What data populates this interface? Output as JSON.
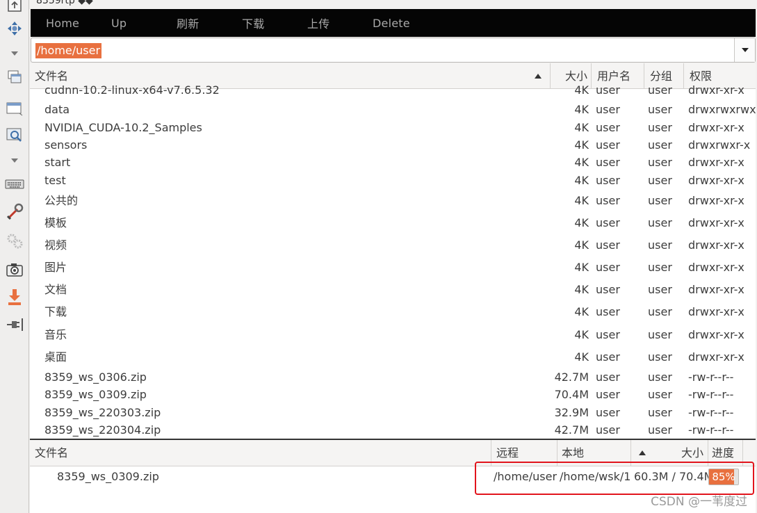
{
  "tab": {
    "title": "8359rtp ◆◆"
  },
  "toolbar": {
    "buttons": [
      "Home",
      "Up",
      "刷新",
      "下载",
      "上传",
      "Delete"
    ]
  },
  "path": {
    "value": "/home/user"
  },
  "file_table": {
    "headers": {
      "name": "文件名",
      "size": "大小",
      "owner": "用户名",
      "group": "分组",
      "perms": "权限"
    },
    "sort": "ascending",
    "rows": [
      {
        "name": "cudnn-10.2-linux-x64-v7.6.5.32",
        "size": "4K",
        "owner": "user",
        "group": "user",
        "perms": "drwxr-xr-x"
      },
      {
        "name": "data",
        "size": "4K",
        "owner": "user",
        "group": "user",
        "perms": "drwxrwxrwx"
      },
      {
        "name": "NVIDIA_CUDA-10.2_Samples",
        "size": "4K",
        "owner": "user",
        "group": "user",
        "perms": "drwxr-xr-x"
      },
      {
        "name": "sensors",
        "size": "4K",
        "owner": "user",
        "group": "user",
        "perms": "drwxrwxr-x"
      },
      {
        "name": "start",
        "size": "4K",
        "owner": "user",
        "group": "user",
        "perms": "drwxr-xr-x"
      },
      {
        "name": "test",
        "size": "4K",
        "owner": "user",
        "group": "user",
        "perms": "drwxr-xr-x"
      },
      {
        "name": "公共的",
        "size": "4K",
        "owner": "user",
        "group": "user",
        "perms": "drwxr-xr-x"
      },
      {
        "name": "模板",
        "size": "4K",
        "owner": "user",
        "group": "user",
        "perms": "drwxr-xr-x"
      },
      {
        "name": "视频",
        "size": "4K",
        "owner": "user",
        "group": "user",
        "perms": "drwxr-xr-x"
      },
      {
        "name": "图片",
        "size": "4K",
        "owner": "user",
        "group": "user",
        "perms": "drwxr-xr-x"
      },
      {
        "name": "文档",
        "size": "4K",
        "owner": "user",
        "group": "user",
        "perms": "drwxr-xr-x"
      },
      {
        "name": "下载",
        "size": "4K",
        "owner": "user",
        "group": "user",
        "perms": "drwxr-xr-x"
      },
      {
        "name": "音乐",
        "size": "4K",
        "owner": "user",
        "group": "user",
        "perms": "drwxr-xr-x"
      },
      {
        "name": "桌面",
        "size": "4K",
        "owner": "user",
        "group": "user",
        "perms": "drwxr-xr-x"
      },
      {
        "name": "8359_ws_0306.zip",
        "size": "42.7M",
        "owner": "user",
        "group": "user",
        "perms": "-rw-r--r--"
      },
      {
        "name": "8359_ws_0309.zip",
        "size": "70.4M",
        "owner": "user",
        "group": "user",
        "perms": "-rw-r--r--"
      },
      {
        "name": "8359_ws_220303.zip",
        "size": "32.9M",
        "owner": "user",
        "group": "user",
        "perms": "-rw-r--r--"
      },
      {
        "name": "8359_ws_220304.zip",
        "size": "42.7M",
        "owner": "user",
        "group": "user",
        "perms": "-rw-r--r--"
      }
    ]
  },
  "transfer_table": {
    "headers": {
      "name": "文件名",
      "remote": "远程",
      "local": "本地",
      "size": "大小",
      "progress": "进度"
    },
    "rows": [
      {
        "name": "8359_ws_0309.zip",
        "remote": "/home/user",
        "local": "/home/wsk/1",
        "size": "60.3M / 70.4M",
        "progress_text": "85%",
        "progress": 0.85
      }
    ]
  },
  "watermark": "CSDN @一苇度过",
  "colors": {
    "accent": "#e8703f",
    "highlight": "#e2141c",
    "bar": "#050505"
  }
}
